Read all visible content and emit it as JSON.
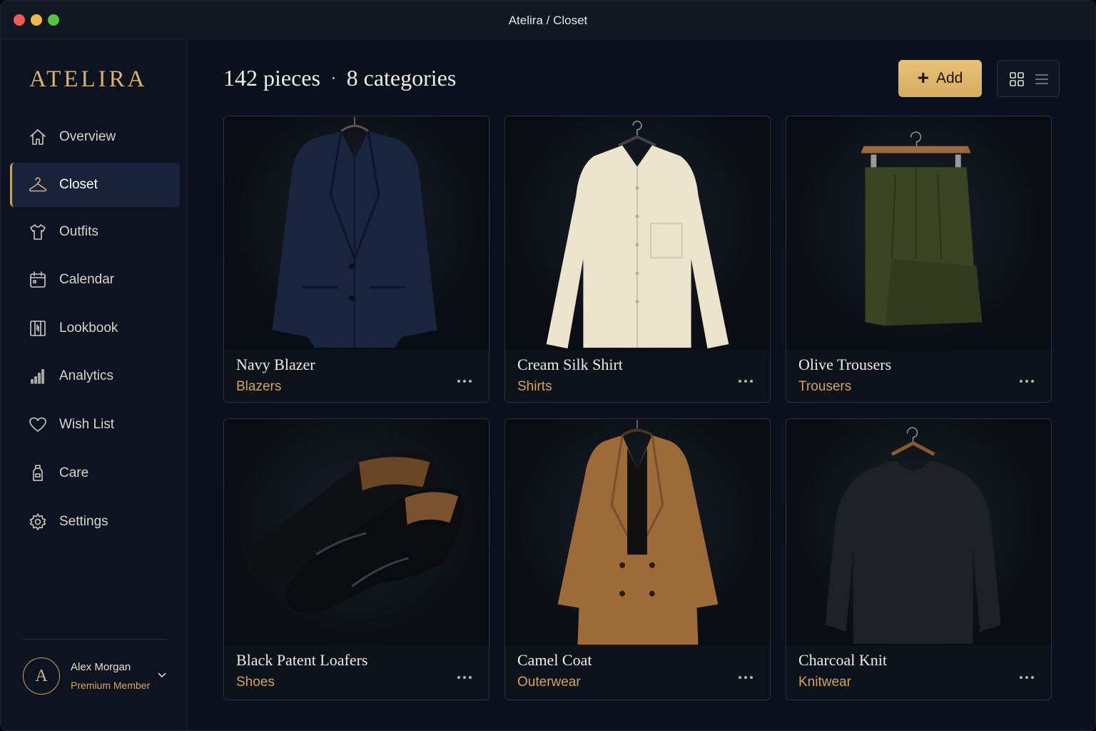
{
  "window": {
    "title": "Atelira / Closet"
  },
  "sidebar": {
    "logo": "ATELIRA",
    "items": [
      {
        "label": "Overview",
        "icon": "home-icon",
        "active": false
      },
      {
        "label": "Closet",
        "icon": "hanger-icon",
        "active": true
      },
      {
        "label": "Outfits",
        "icon": "shirt-icon",
        "active": false
      },
      {
        "label": "Calendar",
        "icon": "calendar-icon",
        "active": false
      },
      {
        "label": "Lookbook",
        "icon": "book-icon",
        "active": false
      },
      {
        "label": "Analytics",
        "icon": "bar-chart-icon",
        "active": false
      },
      {
        "label": "Wish List",
        "icon": "heart-icon",
        "active": false
      },
      {
        "label": "Care",
        "icon": "bottle-icon",
        "active": false
      },
      {
        "label": "Settings",
        "icon": "gear-icon",
        "active": false
      }
    ],
    "user": {
      "initial": "A",
      "name": "Alex Morgan",
      "tier": "Premium Member"
    }
  },
  "header": {
    "pieces": "142 pieces",
    "separator": "·",
    "categories": "8 categories",
    "add_label": "Add",
    "add_symbol": "+"
  },
  "items": [
    {
      "name": "Navy Blazer",
      "category": "Blazers"
    },
    {
      "name": "Cream Silk Shirt",
      "category": "Shirts"
    },
    {
      "name": "Olive Trousers",
      "category": "Trousers"
    },
    {
      "name": "Black Patent Loafers",
      "category": "Shoes"
    },
    {
      "name": "Camel Coat",
      "category": "Outerwear"
    },
    {
      "name": "Charcoal Knit",
      "category": "Knitwear"
    }
  ],
  "colors": {
    "accent": "#d8b272",
    "category_text": "#d4a25a",
    "background": "#0b111d",
    "sidebar": "#0d1320"
  }
}
